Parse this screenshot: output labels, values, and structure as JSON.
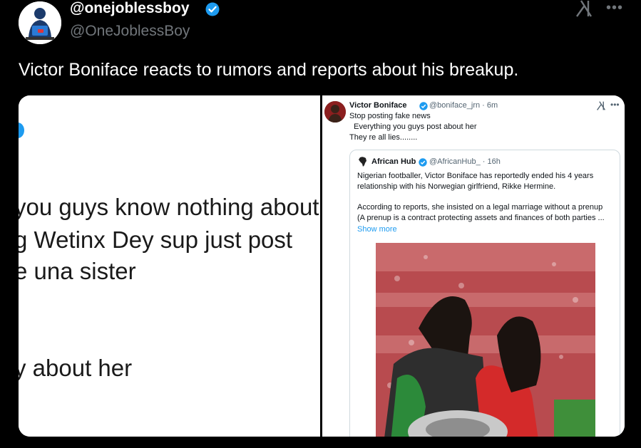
{
  "author": {
    "display_name": "@onejoblessboy",
    "handle": "@OneJoblessBoy"
  },
  "header": {
    "more_label": "•••"
  },
  "tweet": {
    "text": "Victor Boniface reacts to rumors and reports about his breakup."
  },
  "left_pane": {
    "lines": [
      "you guys know nothing about",
      "g Wetinx Dey sup just post",
      "e una sister",
      "y about her"
    ]
  },
  "right_pane": {
    "author_name": "Victor Boniface",
    "meta": "@boniface_jrn · 6m",
    "more_label": "•••",
    "lines": [
      "Stop posting fake news",
      "  Everything you guys post about her",
      "They re all lies........"
    ],
    "quote": {
      "author_name": "African Hub",
      "meta": "@AfricanHub_ · 16h",
      "lines": [
        "Nigerian footballer, Victor Boniface has reportedly ended his 4 years",
        "relationship with his Norwegian girlfriend, Rikke Hermine.",
        "According to reports, she insisted on a legal marriage without a prenup",
        "(A prenup is a contract protecting assets and finances of both parties ..."
      ],
      "show_more": "Show more"
    }
  },
  "colors": {
    "background": "#000000",
    "text_primary": "#e7e9ea",
    "text_secondary": "#71767b",
    "accent_blue": "#1d9bf0"
  }
}
